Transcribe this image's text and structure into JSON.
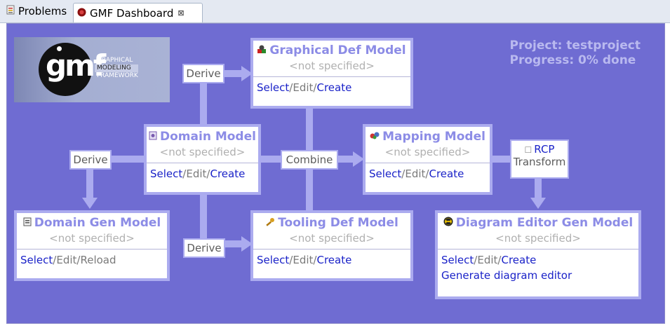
{
  "tabs": [
    {
      "label": "Problems",
      "active": false
    },
    {
      "label": "GMF Dashboard",
      "active": true,
      "close_glyph": "⊠"
    }
  ],
  "logo": {
    "letters": "gmf",
    "line1": "GRAPHICAL",
    "line2": "MODELING",
    "line3": "FRAMEWORK"
  },
  "status": {
    "project": "Project: testproject",
    "progress": "Progress: 0% done"
  },
  "models": {
    "graphical_def": {
      "title": "Graphical Def Model",
      "subtitle": "<not specified>",
      "actions": [
        "Select",
        "Edit",
        "Create"
      ]
    },
    "domain": {
      "title": "Domain Model",
      "subtitle": "<not specified>",
      "actions": [
        "Select",
        "Edit",
        "Create"
      ]
    },
    "mapping": {
      "title": "Mapping Model",
      "subtitle": "<not specified>",
      "actions": [
        "Select",
        "Edit",
        "Create"
      ]
    },
    "domain_gen": {
      "title": "Domain Gen Model",
      "subtitle": "<not specified>",
      "actions": [
        "Select",
        "Edit",
        "Reload"
      ]
    },
    "tooling_def": {
      "title": "Tooling Def Model",
      "subtitle": "<not specified>",
      "actions": [
        "Select",
        "Edit",
        "Create"
      ]
    },
    "diagram_editor_gen": {
      "title": "Diagram Editor Gen Model",
      "subtitle": "<not specified>",
      "actions": [
        "Select",
        "Edit",
        "Create"
      ],
      "extra_action": "Generate diagram editor"
    }
  },
  "separator": "/",
  "connectors": {
    "derive_graphical": "Derive",
    "derive_domain_gen": "Derive",
    "derive_tooling": "Derive",
    "combine": "Combine",
    "rcp_label": "RCP",
    "transform": "Transform"
  },
  "colors": {
    "canvas": "#6f6cd2",
    "connector": "#ababef",
    "title": "#8c8ce6",
    "link": "#1a22c8"
  }
}
